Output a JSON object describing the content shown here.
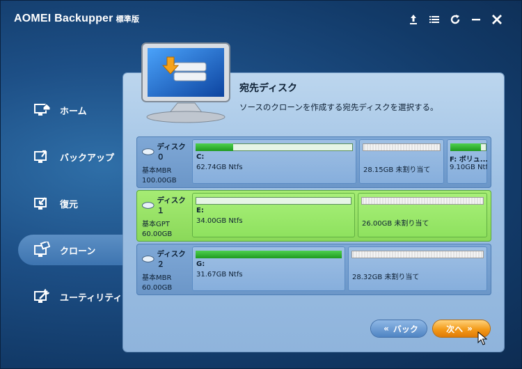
{
  "app": {
    "title": "AOMEI Backupper",
    "edition": "標準版"
  },
  "titlebar_icons": [
    "upload-icon",
    "menu-icon",
    "refresh-icon",
    "minimize-icon",
    "close-icon"
  ],
  "sidebar": {
    "items": [
      {
        "label": "ホーム",
        "icon": "home-icon"
      },
      {
        "label": "バックアップ",
        "icon": "backup-icon"
      },
      {
        "label": "復元",
        "icon": "restore-icon"
      },
      {
        "label": "クローン",
        "icon": "clone-icon",
        "active": true
      },
      {
        "label": "ユーティリティ",
        "icon": "utility-icon"
      }
    ]
  },
  "main": {
    "heading": "宛先ディスク",
    "description": "ソースのクローンを作成する宛先ディスクを選択する。"
  },
  "disks": [
    {
      "name": "ディスク０",
      "type": "基本MBR",
      "size": "100.00GB",
      "partitions": [
        {
          "label": "C:",
          "size": "62.74GB Ntfs",
          "used": 0.24
        },
        {
          "label": "",
          "size": "28.15GB 未割り当て",
          "unallocated": true
        },
        {
          "label": "F: ボリュ...",
          "size": "9.10GB Ntfs",
          "used": 0.85
        }
      ]
    },
    {
      "name": "ディスク１",
      "type": "基本GPT",
      "size": "60.00GB",
      "selected": true,
      "partitions": [
        {
          "label": "E:",
          "size": "34.00GB Ntfs",
          "used": 0.0
        },
        {
          "label": "",
          "size": "26.00GB 未割り当て",
          "unallocated": true
        }
      ]
    },
    {
      "name": "ディスク２",
      "type": "基本MBR",
      "size": "60.00GB",
      "partitions": [
        {
          "label": "G:",
          "size": "31.67GB Ntfs",
          "used": 1.0
        },
        {
          "label": "",
          "size": "28.32GB 未割り当て",
          "unallocated": true
        }
      ]
    }
  ],
  "buttons": {
    "back": "バック",
    "next": "次へ"
  },
  "colors": {
    "accent_next": "#f39a18",
    "selected_disk": "#8ad859",
    "panel": "#a9c7e8"
  }
}
